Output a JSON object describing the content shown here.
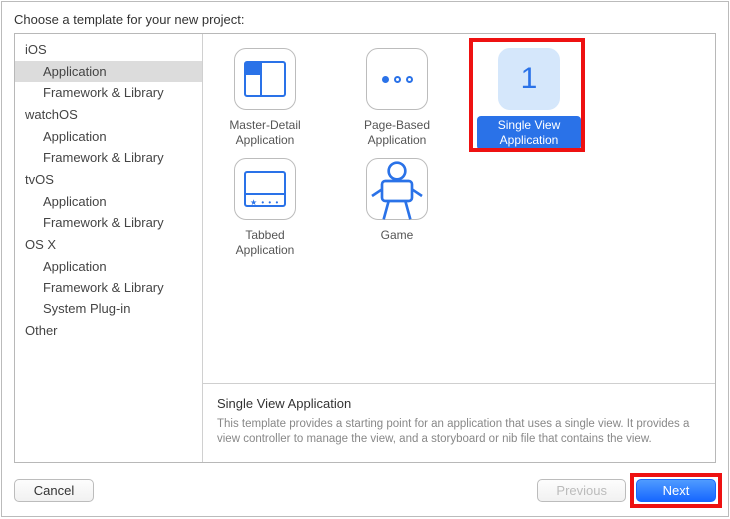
{
  "header": {
    "title": "Choose a template for your new project:"
  },
  "sidebar": {
    "groups": [
      {
        "name": "iOS",
        "items": [
          {
            "label": "Application",
            "selected": true
          },
          {
            "label": "Framework & Library"
          }
        ]
      },
      {
        "name": "watchOS",
        "items": [
          {
            "label": "Application"
          },
          {
            "label": "Framework & Library"
          }
        ]
      },
      {
        "name": "tvOS",
        "items": [
          {
            "label": "Application"
          },
          {
            "label": "Framework & Library"
          }
        ]
      },
      {
        "name": "OS X",
        "items": [
          {
            "label": "Application"
          },
          {
            "label": "Framework & Library"
          },
          {
            "label": "System Plug-in"
          }
        ]
      },
      {
        "name": "Other",
        "items": []
      }
    ]
  },
  "templates": [
    {
      "label": "Master-Detail Application",
      "icon": "master-detail-icon"
    },
    {
      "label": "Page-Based Application",
      "icon": "page-based-icon"
    },
    {
      "label": "Single View Application",
      "icon": "single-view-icon",
      "selected": true,
      "highlighted": true
    },
    {
      "label": "Tabbed Application",
      "icon": "tabbed-icon"
    },
    {
      "label": "Game",
      "icon": "game-icon"
    }
  ],
  "description": {
    "title": "Single View Application",
    "body": "This template provides a starting point for an application that uses a single view. It provides a view controller to manage the view, and a storyboard or nib file that contains the view."
  },
  "footer": {
    "cancel": "Cancel",
    "previous": "Previous",
    "next": "Next"
  }
}
